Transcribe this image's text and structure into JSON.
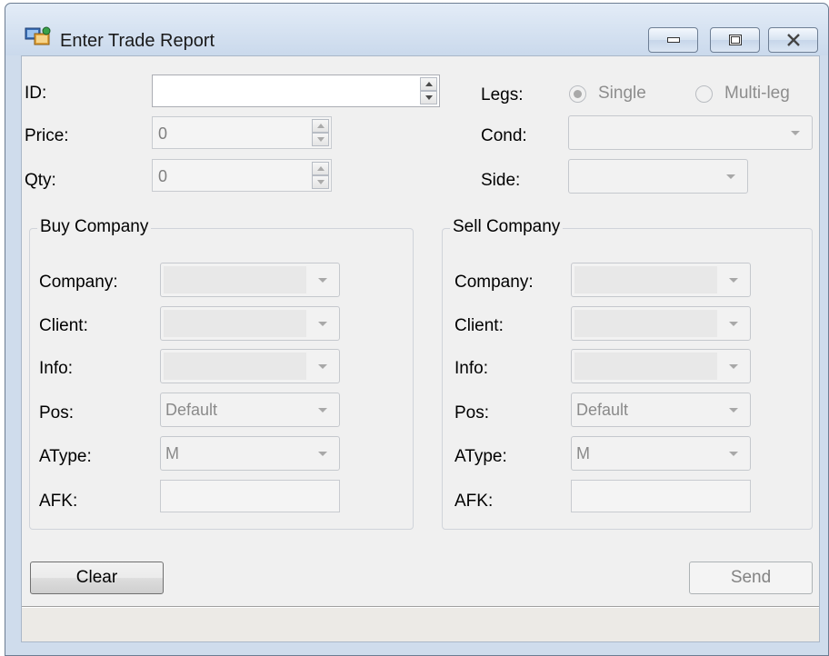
{
  "window": {
    "title": "Enter Trade Report",
    "icon": "trade-report-app-icon",
    "controls": [
      "minimize-icon",
      "maximize-icon",
      "close-icon"
    ]
  },
  "top": {
    "id": {
      "label": "ID:",
      "value": ""
    },
    "price": {
      "label": "Price:",
      "value": "0"
    },
    "qty": {
      "label": "Qty:",
      "value": "0"
    },
    "legs": {
      "label": "Legs:",
      "option_single": "Single",
      "option_multi": "Multi-leg",
      "selected": "Single"
    },
    "cond": {
      "label": "Cond:",
      "value": ""
    },
    "side": {
      "label": "Side:",
      "value": ""
    }
  },
  "buy": {
    "title": "Buy Company",
    "company_label": "Company:",
    "company_value": "",
    "client_label": "Client:",
    "client_value": "",
    "info_label": "Info:",
    "info_value": "",
    "pos_label": "Pos:",
    "pos_value": "Default",
    "atype_label": "AType:",
    "atype_value": "M",
    "afk_label": "AFK:",
    "afk_value": ""
  },
  "sell": {
    "title": "Sell Company",
    "company_label": "Company:",
    "company_value": "",
    "client_label": "Client:",
    "client_value": "",
    "info_label": "Info:",
    "info_value": "",
    "pos_label": "Pos:",
    "pos_value": "Default",
    "atype_label": "AType:",
    "atype_value": "M",
    "afk_label": "AFK:",
    "afk_value": ""
  },
  "buttons": {
    "clear": "Clear",
    "send": "Send"
  },
  "colors": {
    "window_frame": "#cfdcec",
    "client_bg": "#f0f0f0",
    "disabled_text": "#8a8a8a"
  }
}
